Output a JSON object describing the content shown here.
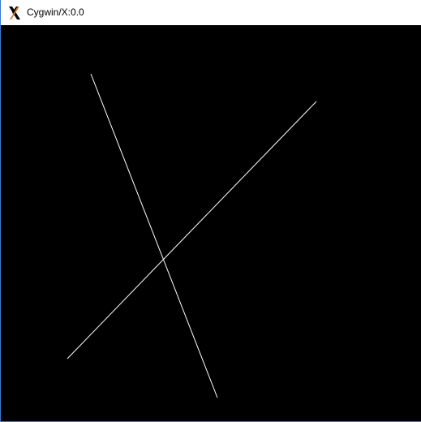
{
  "window": {
    "title": "Cygwin/X:0.0",
    "icon": "x-window-system-icon",
    "background_color": "#000000",
    "line_color": "#ffffff"
  }
}
